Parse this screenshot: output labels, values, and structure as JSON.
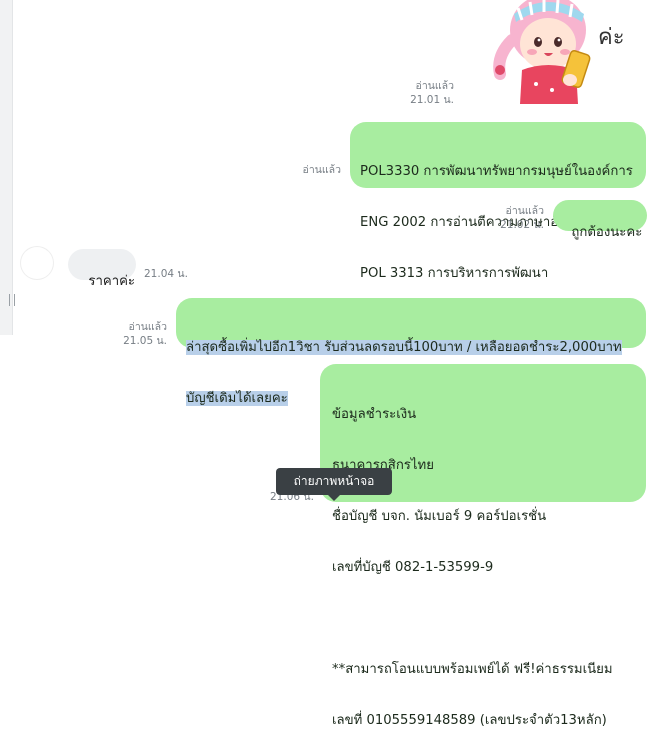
{
  "messages": [
    {
      "id": "m1",
      "read": "อ่านแล้ว",
      "time": "21.01 น."
    },
    {
      "id": "m2",
      "read": "อ่านแล้ว",
      "lines": [
        "POL3330 การพัฒนาทรัพยากรมนุษย์ในองค์การ",
        "ENG 2002 การอ่านตีความภาษาอังกฤษ",
        "POL 3313 การบริหารการพัฒนา"
      ]
    },
    {
      "id": "m3",
      "read": "อ่านแล้ว",
      "time": "21.02 น.",
      "text": "ถูกต้องนะคะ"
    },
    {
      "id": "m4",
      "text": "ราคาค่ะ",
      "time": "21.04 น."
    },
    {
      "id": "m5",
      "read": "อ่านแล้ว",
      "time": "21.05 น.",
      "lines": [
        "ล่าสุดซื้อเพิ่มไปอีก1วิชา รับส่วนลดรอบนี้100บาท / เหลือยอดชำระ2,000บาท",
        "บัญชีเดิมได้เลยคะ"
      ]
    },
    {
      "id": "m6",
      "time": "21.06 น.",
      "lines": [
        "ข้อมูลชำระเงิน",
        "ธนาคารกสิกรไทย",
        "ชื่อบัญชี บจก. นัมเบอร์ 9 คอร์ปอเรชั่น",
        "เลขที่บัญชี 082-1-53599-9",
        "",
        "**สามารถโอนแบบพร้อมเพย์ได้ ฟรี!ค่าธรรมเนียม",
        "เลขที่ 0105559148589 (เลขประจำตัว13หลัก)"
      ]
    }
  ],
  "sticker": {
    "caption": "ค่ะ"
  },
  "tooltip": {
    "label": "ถ่ายภาพหน้าจอ"
  },
  "colors": {
    "outgoing_bubble": "#a8eda0",
    "incoming_bubble": "#eef0f2",
    "selection": "#b8cfe9",
    "tooltip_bg": "#3a4044"
  }
}
